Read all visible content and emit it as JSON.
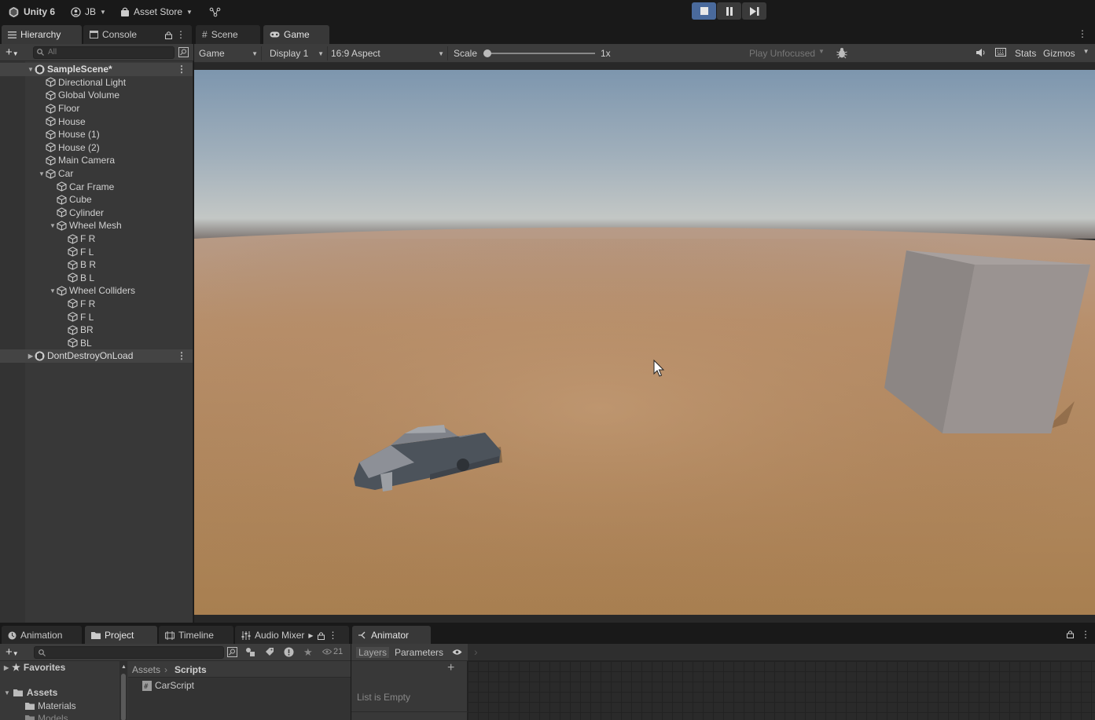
{
  "toolbar": {
    "app_title": "Unity 6",
    "account": "JB",
    "asset_store": "Asset Store"
  },
  "top_tabs": {
    "hierarchy": "Hierarchy",
    "console": "Console",
    "scene": "Scene",
    "game": "Game"
  },
  "hierarchy": {
    "search_placeholder": "All",
    "items": [
      {
        "label": "SampleScene*"
      },
      {
        "label": "Directional Light"
      },
      {
        "label": "Global Volume"
      },
      {
        "label": "Floor"
      },
      {
        "label": "House"
      },
      {
        "label": "House (1)"
      },
      {
        "label": "House (2)"
      },
      {
        "label": "Main Camera"
      },
      {
        "label": "Car"
      },
      {
        "label": "Car Frame"
      },
      {
        "label": "Cube"
      },
      {
        "label": "Cylinder"
      },
      {
        "label": "Wheel Mesh"
      },
      {
        "label": "F R"
      },
      {
        "label": "F L"
      },
      {
        "label": "B R"
      },
      {
        "label": "B L"
      },
      {
        "label": "Wheel Colliders"
      },
      {
        "label": "F R"
      },
      {
        "label": "F L"
      },
      {
        "label": "BR"
      },
      {
        "label": "BL"
      },
      {
        "label": "DontDestroyOnLoad"
      }
    ]
  },
  "game_toolbar": {
    "view": "Game",
    "display": "Display 1",
    "aspect": "16:9 Aspect",
    "scale_label": "Scale",
    "scale_value": "1x",
    "play_mode": "Play Unfocused",
    "stats": "Stats",
    "gizmos": "Gizmos"
  },
  "bottom_tabs": {
    "animation": "Animation",
    "project": "Project",
    "timeline": "Timeline",
    "audio_mixer": "Audio Mixer",
    "animator": "Animator"
  },
  "project": {
    "hidden_count": "21",
    "favorites": "Favorites",
    "assets": "Assets",
    "materials": "Materials",
    "models": "Models",
    "breadcrumb_root": "Assets",
    "breadcrumb_current": "Scripts",
    "file": "CarScript"
  },
  "animator": {
    "layers_tab": "Layers",
    "parameters_tab": "Parameters",
    "empty_text": "List is Empty"
  },
  "colors": {
    "accent": "#4a6a9c",
    "ground": "#b08c68",
    "sky_top": "#7d96ae"
  }
}
